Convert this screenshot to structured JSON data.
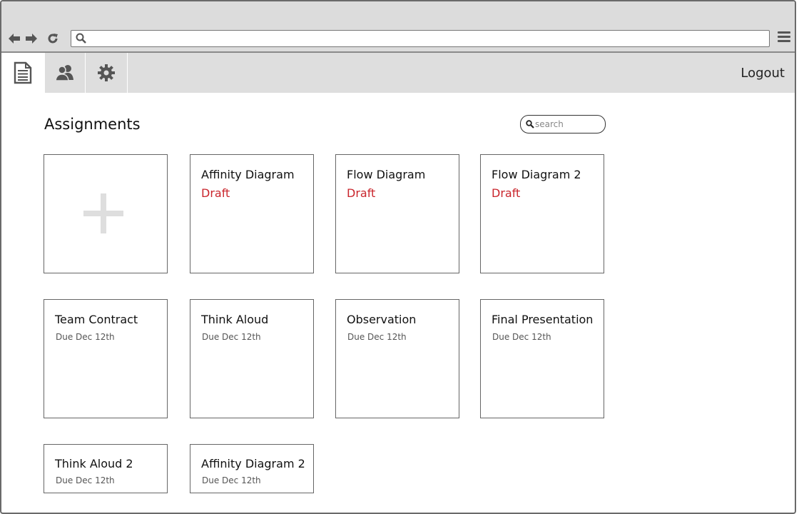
{
  "browser": {
    "back_icon": "arrow-left-icon",
    "forward_icon": "arrow-right-icon",
    "reload_icon": "reload-icon",
    "url": "",
    "menu_icon": "hamburger-menu-icon"
  },
  "appbar": {
    "tabs": [
      {
        "icon": "document-icon",
        "active": true
      },
      {
        "icon": "users-icon",
        "active": false
      },
      {
        "icon": "gear-icon",
        "active": false
      }
    ],
    "logout_label": "Logout"
  },
  "page": {
    "title": "Assignments",
    "search": {
      "placeholder": "search",
      "value": ""
    }
  },
  "add_card": {
    "icon": "plus-icon"
  },
  "assignments": [
    {
      "name": "Affinity Diagram",
      "status": "Draft"
    },
    {
      "name": "Flow Diagram",
      "status": "Draft"
    },
    {
      "name": "Flow Diagram 2",
      "status": "Draft"
    },
    {
      "name": "Team Contract",
      "due": "Due Dec 12th"
    },
    {
      "name": "Think Aloud",
      "due": "Due Dec 12th"
    },
    {
      "name": "Observation",
      "due": "Due Dec 12th"
    },
    {
      "name": "Final Presentation",
      "due": "Due Dec 12th"
    },
    {
      "name": "Think Aloud 2",
      "due": "Due Dec 12th"
    },
    {
      "name": "Affinity Diagram 2",
      "due": "Due Dec 12th"
    }
  ],
  "colors": {
    "draft": "#c9252c",
    "chrome": "#dcdcdc",
    "icon": "#555555"
  }
}
